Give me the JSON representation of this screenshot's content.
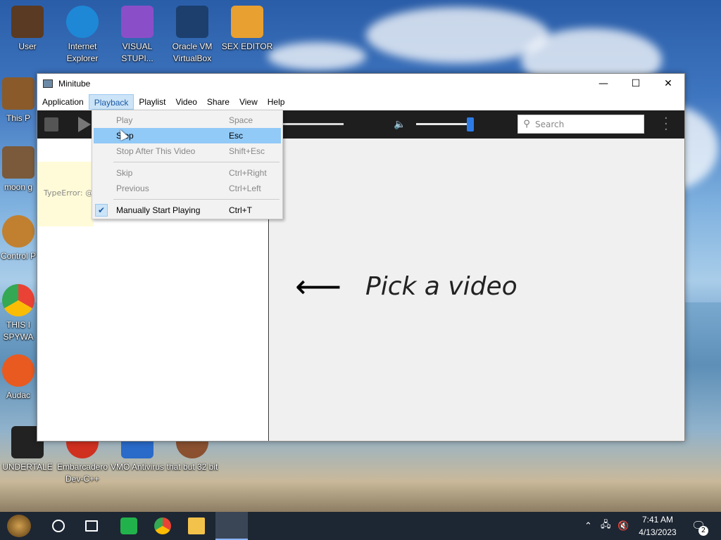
{
  "desktop": {
    "icons": [
      {
        "label": "User",
        "color": "#5a3a22"
      },
      {
        "label": "Internet Explorer",
        "color": "#1e88d6"
      },
      {
        "label": "VISUAL STUPI...",
        "color": "#8a4fc8"
      },
      {
        "label": "Oracle VM VirtualBox",
        "color": "#1c3f6e"
      },
      {
        "label": "SEX EDITOR",
        "color": "#e8a030"
      },
      {
        "label": "This P",
        "color": "#8a5a2a"
      },
      {
        "label": "moon g",
        "color": "#7a5a3a"
      },
      {
        "label": "Control P",
        "color": "#c08030"
      },
      {
        "label": "THIS I SPYWA",
        "color": "#4285f4"
      },
      {
        "label": "Audac",
        "color": "#e85a20"
      },
      {
        "label": "UNDERTALE",
        "color": "#222222"
      },
      {
        "label": "Embarcadero Dev-C++",
        "color": "#d03020"
      },
      {
        "label": "VMO Antivirus",
        "color": "#2a6ac8"
      },
      {
        "label": "that but 32 bit",
        "color": "#8a5030"
      }
    ]
  },
  "window": {
    "title": "Minitube",
    "controls": {
      "minimize": "—",
      "maximize": "☐",
      "close": "✕"
    },
    "menu": [
      "Application",
      "Playback",
      "Playlist",
      "Video",
      "Share",
      "View",
      "Help"
    ],
    "active_menu": "Playback"
  },
  "toolbar": {
    "search_placeholder": "Search",
    "volume_level": 0.9
  },
  "left_pane": {
    "error_text": "TypeError: @"
  },
  "main": {
    "arrow": "⟵",
    "pick_text": "Pick a video"
  },
  "dropdown": {
    "items": [
      {
        "label": "Play",
        "shortcut": "Space",
        "enabled": false
      },
      {
        "label": "Stop",
        "shortcut": "Esc",
        "enabled": true,
        "highlighted": true
      },
      {
        "label": "Stop After This Video",
        "shortcut": "Shift+Esc",
        "enabled": false
      },
      {
        "label": "Skip",
        "shortcut": "Ctrl+Right",
        "enabled": false
      },
      {
        "label": "Previous",
        "shortcut": "Ctrl+Left",
        "enabled": false
      },
      {
        "label": "Manually Start Playing",
        "shortcut": "Ctrl+T",
        "enabled": true,
        "checked": true
      }
    ]
  },
  "taskbar": {
    "clock_time": "7:41 AM",
    "clock_date": "4/13/2023",
    "notification_count": "2"
  }
}
